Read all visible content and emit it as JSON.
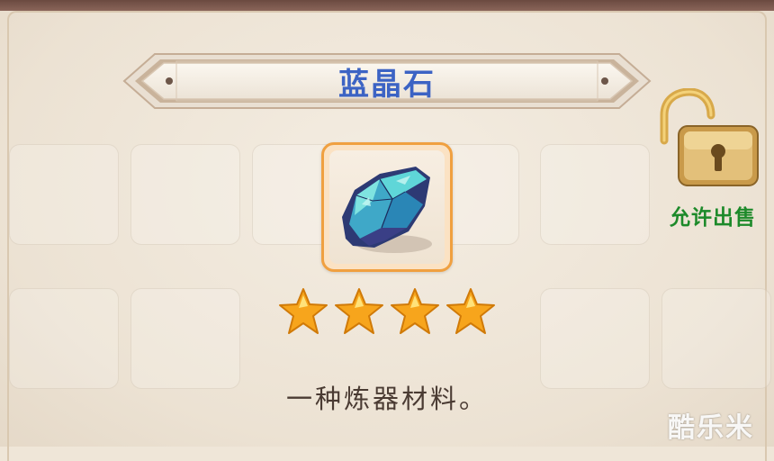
{
  "item": {
    "name": "蓝晶石",
    "stars": 4,
    "description": "一种炼器材料。",
    "icon": "blue-crystal-icon"
  },
  "sell_toggle": {
    "label": "允许出售",
    "icon": "unlocked-padlock-icon"
  },
  "watermark": "酷乐米",
  "colors": {
    "title": "#3c63c4",
    "sell_label": "#1d8a2a",
    "frame": "#f0a040",
    "star": "#f7a51c"
  }
}
